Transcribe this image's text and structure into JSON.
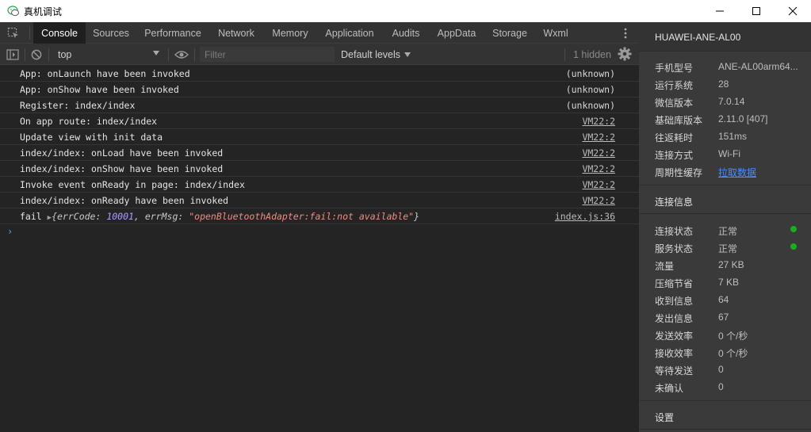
{
  "window": {
    "title": "真机调试",
    "minimize_glyph": "—",
    "maximize_glyph": "☐",
    "close_glyph": "✕"
  },
  "tabs": [
    {
      "label": "Console",
      "active": true
    },
    {
      "label": "Sources"
    },
    {
      "label": "Performance"
    },
    {
      "label": "Network"
    },
    {
      "label": "Memory"
    },
    {
      "label": "Application"
    },
    {
      "label": "Audits"
    },
    {
      "label": "AppData"
    },
    {
      "label": "Storage"
    },
    {
      "label": "Wxml"
    }
  ],
  "toolbar": {
    "context": "top",
    "filter_placeholder": "Filter",
    "levels": "Default levels",
    "hidden": "1 hidden"
  },
  "console": {
    "rows": [
      {
        "msg": "App: onLaunch have been invoked",
        "src": "(unknown)"
      },
      {
        "msg": "App: onShow have been invoked",
        "src": "(unknown)"
      },
      {
        "msg": "Register: index/index",
        "src": "(unknown)"
      },
      {
        "msg": "On app route: index/index",
        "src": "VM22:2"
      },
      {
        "msg": "Update view with init data",
        "src": "VM22:2"
      },
      {
        "msg": "index/index: onLoad have been invoked",
        "src": "VM22:2"
      },
      {
        "msg": "index/index: onShow have been invoked",
        "src": "VM22:2"
      },
      {
        "msg": "Invoke event onReady in page: index/index",
        "src": "VM22:2"
      },
      {
        "msg": "index/index: onReady have been invoked",
        "src": "VM22:2"
      }
    ],
    "fail": {
      "prefix": "fail",
      "arrow": "▶",
      "open": "{",
      "key1": "errCode:",
      "val1": "10001",
      "comma": ",",
      "key2": "errMsg:",
      "val2": "\"openBluetoothAdapter:fail:not available\"",
      "close": "}",
      "src": "index.js:36"
    },
    "prompt": "›"
  },
  "side": {
    "device": "HUAWEI-ANE-AL00",
    "info": [
      {
        "k": "手机型号",
        "v": "ANE-AL00arm64..."
      },
      {
        "k": "运行系统",
        "v": "28"
      },
      {
        "k": "微信版本",
        "v": "7.0.14"
      },
      {
        "k": "基础库版本",
        "v": "2.11.0 [407]"
      },
      {
        "k": "往返耗时",
        "v": "151ms"
      },
      {
        "k": "连接方式",
        "v": "Wi-Fi"
      },
      {
        "k": "周期性缓存",
        "v": "拉取数据"
      }
    ],
    "conn_title": "连接信息",
    "conn": [
      {
        "k": "连接状态",
        "v": "正常"
      },
      {
        "k": "服务状态",
        "v": "正常"
      },
      {
        "k": "流量",
        "v": "27 KB"
      },
      {
        "k": "压缩节省",
        "v": "7 KB"
      },
      {
        "k": "收到信息",
        "v": "64"
      },
      {
        "k": "发出信息",
        "v": "67"
      },
      {
        "k": "发送效率",
        "v": "0 个/秒"
      },
      {
        "k": "接收效率",
        "v": "0 个/秒"
      },
      {
        "k": "等待发送",
        "v": "0"
      },
      {
        "k": "未确认",
        "v": "0"
      }
    ],
    "settings": "设置",
    "status_color": "#1aad19"
  }
}
